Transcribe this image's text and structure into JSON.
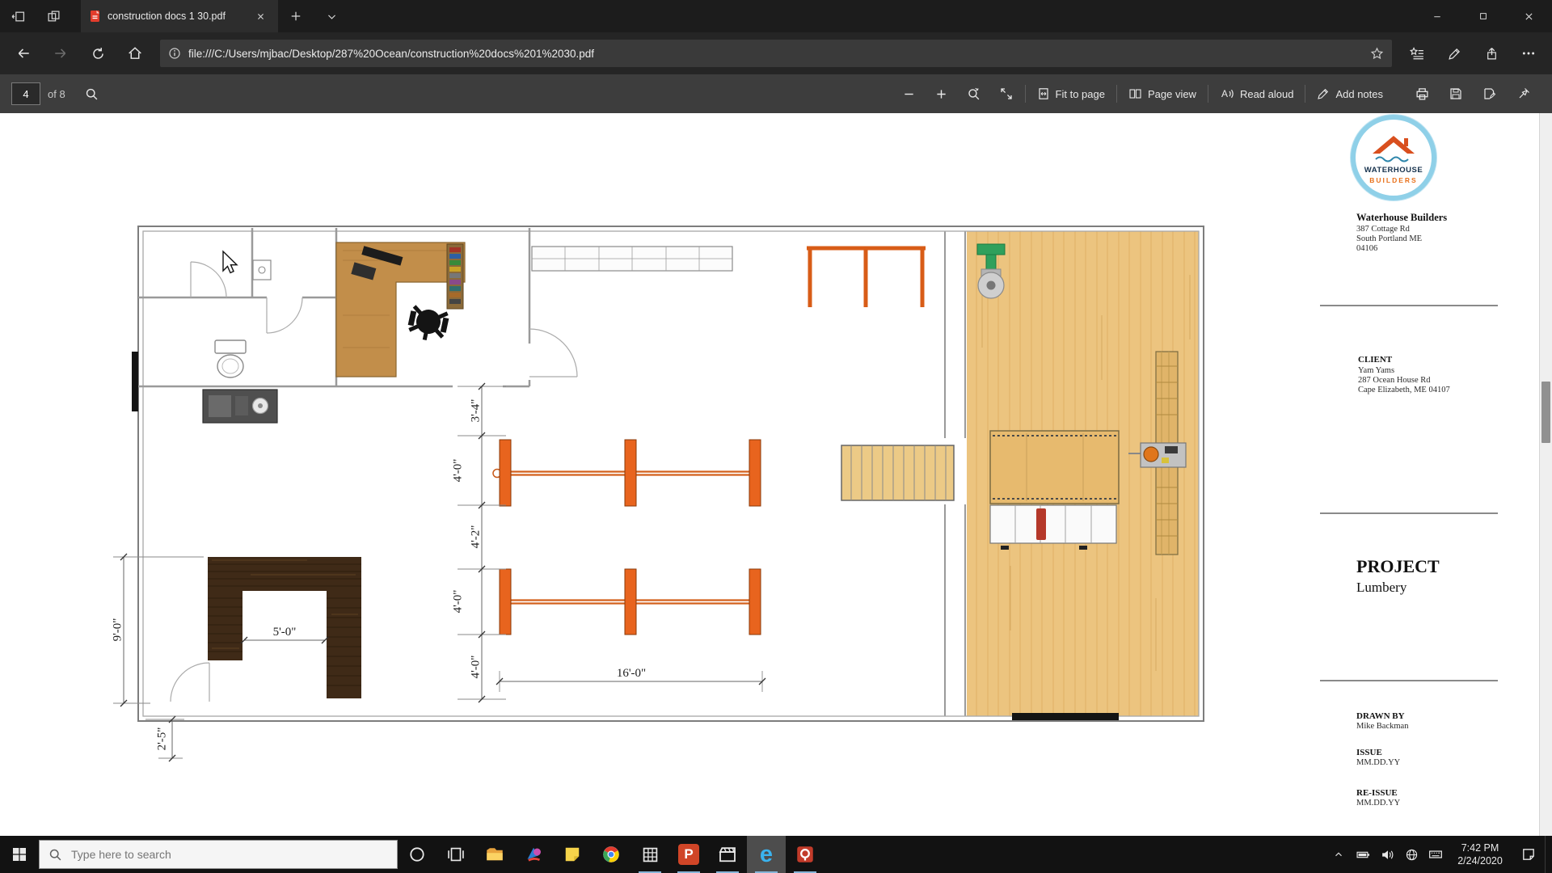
{
  "browser": {
    "tab_title": "construction docs 1 30.pdf",
    "url": "file:///C:/Users/mjbac/Desktop/287%20Ocean/construction%20docs%201%2030.pdf"
  },
  "pdf_toolbar": {
    "page_number": "4",
    "page_count_label": "of 8",
    "fit_to_page": "Fit to page",
    "page_view": "Page view",
    "read_aloud": "Read aloud",
    "add_notes": "Add notes",
    "read_aloud_glyph": "A"
  },
  "plan": {
    "dims": {
      "d34": "3'-4\"",
      "d40a": "4'-0\"",
      "d42": "4'-2\"",
      "d40b": "4'-0\"",
      "d40c": "4'-0\"",
      "d160": "16'-0\"",
      "d90": "9'-0\"",
      "d50": "5'-0\"",
      "d25": "2'-5\""
    }
  },
  "title_block": {
    "logo_line1": "WATERHOUSE",
    "logo_line2": "BUILDERS",
    "company": "Waterhouse Builders",
    "address1": "387 Cottage Rd",
    "address2": "South Portland ME",
    "address3": "04106",
    "client_label": "CLIENT",
    "client_name": "Yam Yams",
    "client_address1": "287 Ocean House Rd",
    "client_address2": "Cape Elizabeth, ME 04107",
    "project_label": "PROJECT",
    "project_name": "Lumbery",
    "drawn_by_label": "DRAWN BY",
    "drawn_by": "Mike Backman",
    "issue_label": "ISSUE",
    "issue_date": "MM.DD.YY",
    "reissue_label": "RE-ISSUE",
    "reissue_date": "MM.DD.YY"
  },
  "taskbar": {
    "search_placeholder": "Type here to search",
    "time": "7:42 PM",
    "date": "2/24/2020",
    "edge_glyph": "e",
    "ppt_glyph": "P"
  }
}
